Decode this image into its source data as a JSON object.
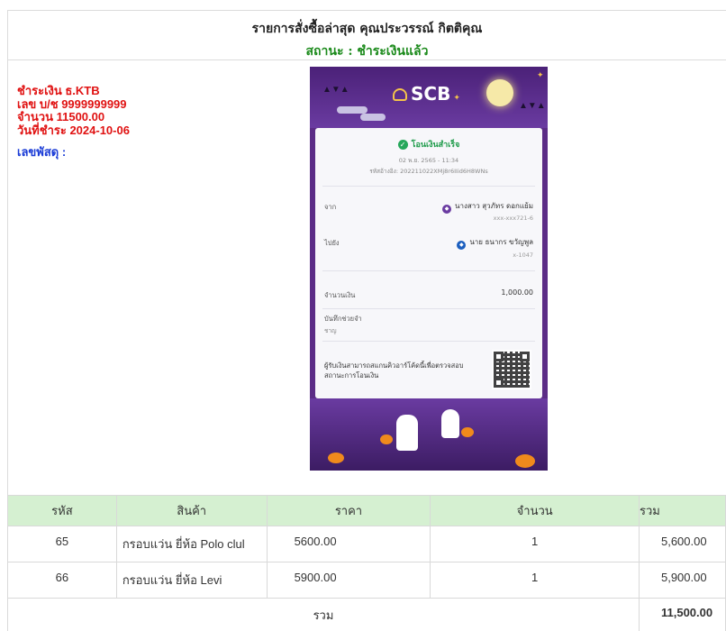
{
  "header": {
    "title": "รายการสั่งซื้อล่าสุด คุณประวรรณ์ กิตติคุณ",
    "status": "สถานะ : ชำระเงินแล้ว"
  },
  "payment": {
    "bank": "ชำระเงิน ธ.KTB",
    "account": "เลข บ/ช 9999999999",
    "amount": "จำนวน 11500.00",
    "date": "วันที่ชำระ 2024-10-06",
    "tracking_label": "เลขพัสดุ :"
  },
  "slip": {
    "brand": "SCB",
    "success": "โอนเงินสำเร็จ",
    "datetime": "02 พ.ย. 2565 - 11:34",
    "ref": "รหัสอ้างอิง: 202211022XMj8r6IIid6H8WNs",
    "from_label": "จาก",
    "from_name": "นางสาว สุวภัทร ดอกแย้ม",
    "from_account": "xxx-xxx721-6",
    "to_label": "ไปยัง",
    "to_name": "นาย ธนากร ขวัญพูล",
    "to_account": "x-1047",
    "amount_label": "จำนวนเงิน",
    "amount": "1,000.00",
    "memo_label": "บันทึกช่วยจำ",
    "memo": "ชาญ",
    "verify": "ผู้รับเงินสามารถสแกนคิวอาร์โค้ดนี้เพื่อตรวจสอบสถานะการโอนเงิน"
  },
  "table": {
    "headers": [
      "รหัส",
      "สินค้า",
      "ราคา",
      "จำนวน",
      "รวม"
    ],
    "rows": [
      {
        "code": "65",
        "name": "กรอบแว่น ยี่ห้อ Polo clul",
        "price": "5600.00",
        "qty": "1",
        "total": "5,600.00"
      },
      {
        "code": "66",
        "name": "กรอบแว่น ยี่ห้อ Levi",
        "price": "5900.00",
        "qty": "1",
        "total": "5,900.00"
      }
    ],
    "sum_label": "รวม",
    "sum_value": "11,500.00"
  },
  "colors": {
    "status": "#1b8a1b",
    "payment_text": "#e01212",
    "tracking_text": "#1a3bd6",
    "table_header_bg": "#d5f0d1",
    "slip_purple": "#5b2c86"
  }
}
